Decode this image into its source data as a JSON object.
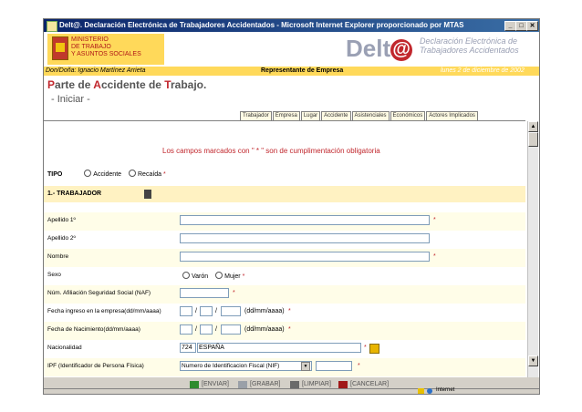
{
  "window": {
    "title": "Delt@. Declaración Electrónica de Trabajadores Accidentados - Microsoft Internet Explorer proporcionado por MTAS"
  },
  "header": {
    "ministry_lines": [
      "MINISTERIO",
      "DE TRABAJO",
      "Y ASUNTOS SOCIALES"
    ],
    "logo_text": "Delt",
    "logo_at": "@",
    "subtitle_line1": "Declaración Electrónica de",
    "subtitle_line2": "Trabajadores Accidentados"
  },
  "userbar": {
    "user": "Don/Doña: Ignacio Martínez Arrieta",
    "role": "Representante de Empresa",
    "date": "lunes 2 de diciembre de 2002"
  },
  "page": {
    "title_cap": "P",
    "title_rest1": "arte de ",
    "title_cap2": "A",
    "title_rest2": "ccidente de ",
    "title_cap3": "T",
    "title_rest3": "rabajo.",
    "subtitle": "- Iniciar -"
  },
  "tabs": [
    "Trabajador",
    "Empresa",
    "Lugar",
    "Accidente",
    "Asistenciales",
    "Económicos",
    "Actores Implicados"
  ],
  "notice": "Los campos marcados con \" * \" son de cumplimentación obligatoria",
  "tipo": {
    "label": "TIPO",
    "opt1": "Accidente",
    "opt2": "Recaída",
    "req": "*"
  },
  "section": {
    "label": "1.- TRABAJADOR"
  },
  "fields": {
    "apellido1": "Apellido 1º",
    "apellido2": "Apellido 2º",
    "nombre": "Nombre",
    "sexo": "Sexo",
    "sexo_opt1": "Varón",
    "sexo_opt2": "Mujer",
    "naf": "Núm. Afiliación Seguridad  Social (NAF)",
    "fecha_ingreso": "Fecha ingreso en la empresa(dd/mm/aaaa)",
    "fecha_nac": "Fecha de Nacimiento(dd/mm/aaaa)",
    "date_hint": "(dd/mm/aaaa)",
    "sep": "/",
    "nacionalidad": "Nacionalidad",
    "nac_code": "724",
    "nac_value": "ESPAÑA",
    "ipf": "IPF (Identificador de Persona Física)",
    "ipf_select": "Numero de Identificacion Fiscal (NIF)",
    "req": "*"
  },
  "footer": {
    "enviar": "[ENVIAR]",
    "grabar": "[GRABAR]",
    "limpiar": "[LIMPIAR]",
    "cancelar": "[CANCELAR]"
  },
  "status": {
    "zone": "Internet"
  }
}
